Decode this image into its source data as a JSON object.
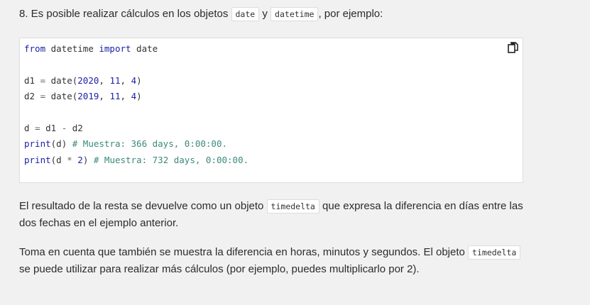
{
  "intro": {
    "prefix": "8. Es posible realizar cálculos en los objetos ",
    "code1": "date",
    "mid": " y ",
    "code2": "datetime",
    "suffix": ", por ejemplo:"
  },
  "code": {
    "line1": {
      "kw1": "from",
      "mod": " datetime ",
      "kw2": "import",
      "name": " date"
    },
    "line3": {
      "var": "d1 ",
      "eq": "=",
      "fn": " date(",
      "a": "2020",
      "s1": ", ",
      "b": "11",
      "s2": ", ",
      "c": "4",
      "end": ")"
    },
    "line4": {
      "var": "d2 ",
      "eq": "=",
      "fn": " date(",
      "a": "2019",
      "s1": ", ",
      "b": "11",
      "s2": ", ",
      "c": "4",
      "end": ")"
    },
    "line6": {
      "var": "d ",
      "eq": "=",
      "a": " d1 ",
      "op": "-",
      "b": " d2"
    },
    "line7": {
      "fn": "print",
      "args": "(d) ",
      "comment": "# Muestra: 366 days, 0:00:00."
    },
    "line8": {
      "fn": "print",
      "open": "(d ",
      "op": "*",
      "sp": " ",
      "num": "2",
      "close": ") ",
      "comment": "# Muestra: 732 days, 0:00:00."
    },
    "copy_icon": "copy-icon"
  },
  "para2": {
    "prefix": "El resultado de la resta se devuelve como un objeto ",
    "code": "timedelta",
    "suffix": " que expresa la diferencia en días entre las dos fechas en el ejemplo anterior."
  },
  "para3": {
    "prefix": "Toma en cuenta que también se muestra la diferencia en horas, minutos y segundos. El objeto ",
    "code": "timedelta",
    "suffix": " se puede utilizar para realizar más cálculos (por ejemplo, puedes multiplicarlo por 2)."
  }
}
